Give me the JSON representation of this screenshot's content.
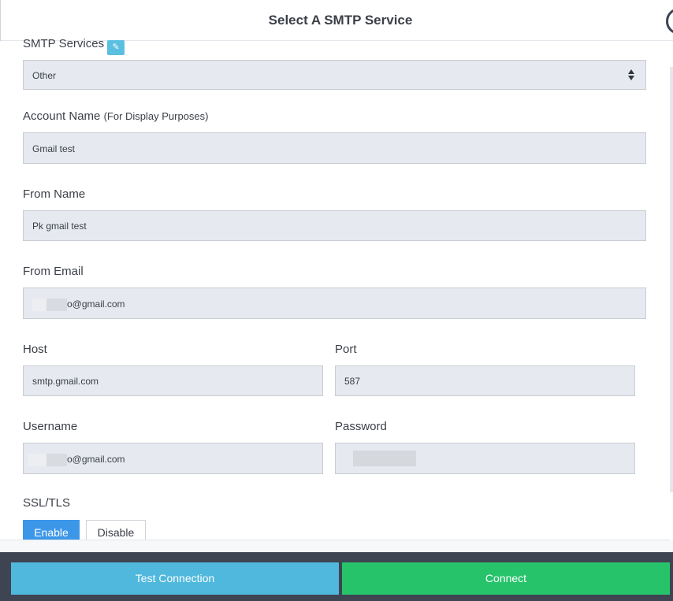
{
  "header": {
    "title": "Select A SMTP Service"
  },
  "form": {
    "smtp_services": {
      "label": "SMTP Services",
      "info_icon": "doc-icon",
      "selected": "Other"
    },
    "account_name": {
      "label": "Account Name",
      "hint": "(For Display Purposes)",
      "value": "Gmail test"
    },
    "from_name": {
      "label": "From Name",
      "value": "Pk gmail test"
    },
    "from_email": {
      "label": "From Email",
      "value": "o@gmail.com"
    },
    "host": {
      "label": "Host",
      "value": "smtp.gmail.com"
    },
    "port": {
      "label": "Port",
      "value": "587"
    },
    "username": {
      "label": "Username",
      "value": "o@gmail.com"
    },
    "password": {
      "label": "Password"
    },
    "ssl_tls": {
      "label": "SSL/TLS",
      "enable_label": "Enable",
      "disable_label": "Disable",
      "selected": "Enable"
    }
  },
  "footer": {
    "test_label": "Test Connection",
    "connect_label": "Connect"
  },
  "colors": {
    "accent_blue": "#3d97e8",
    "test_button": "#50b8dc",
    "connect_button": "#27c36b",
    "footer_bg": "#3e4451",
    "field_bg": "#e6e9ef"
  }
}
